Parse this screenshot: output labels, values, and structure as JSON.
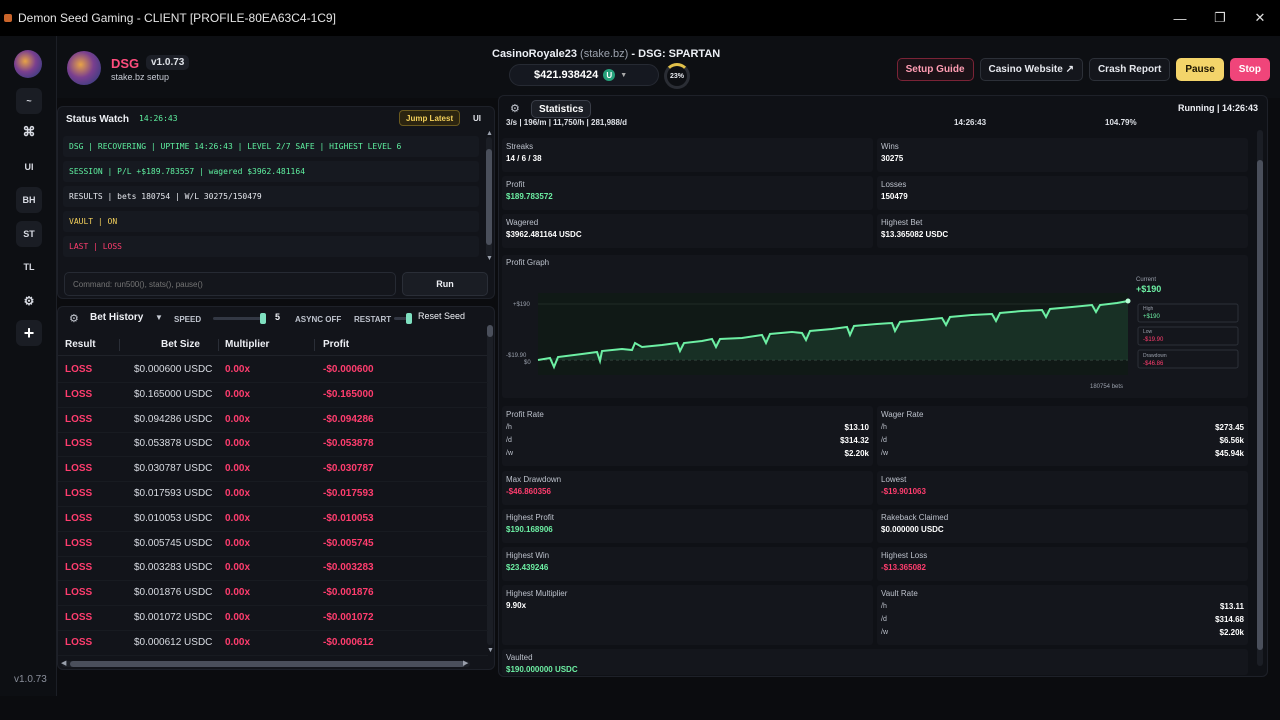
{
  "window": {
    "title": "Demon Seed Gaming - CLIENT [PROFILE-80EA63C4-1C9]",
    "controls": [
      "—",
      "❐",
      "✕"
    ]
  },
  "rail": {
    "items": [
      "~",
      "⌘",
      "UI",
      "BH",
      "ST",
      "TL",
      "⚙",
      "+"
    ],
    "version": "v1.0.73"
  },
  "header": {
    "name": "DSG",
    "version": "v1.0.73",
    "subtitle": "stake.bz setup",
    "account": "CasinoRoyale23",
    "account_site": "(stake.bz)",
    "account_mode": "- DSG: SPARTAN",
    "balance": "$421.938424",
    "coin_letter": "U",
    "progress_pct": 23,
    "progress_label": "23%",
    "buttons": {
      "setup_guide": "Setup Guide",
      "casino_website": "Casino Website ↗",
      "crash_report": "Crash Report",
      "pause": "Pause",
      "stop": "Stop"
    }
  },
  "status_watch": {
    "title": "Status Watch",
    "time": "14:26:43",
    "jump_latest": "Jump Latest",
    "ui": "UI",
    "lines": [
      {
        "text": "DSG | RECOVERING | UPTIME 14:26:43 | LEVEL 2/7 SAFE | HIGHEST LEVEL 6",
        "color": "#5ff0a0"
      },
      {
        "text": "SESSION | P/L +$189.783557 | wagered $3962.481164",
        "color": "#5ff0a0"
      },
      {
        "text": "RESULTS | bets 180754 | W/L 30275/150479",
        "color": "#e6e8ee"
      },
      {
        "text": "VAULT | ON",
        "color": "#f2cf5b"
      },
      {
        "text": "LAST | LOSS",
        "color": "#ff3d6e"
      }
    ],
    "command_placeholder": "Command: run500(), stats(), pause()",
    "run": "Run"
  },
  "bet_history": {
    "selector": "Bet History",
    "speed_label": "SPEED",
    "speed_value": "5",
    "async_label": "ASYNC OFF",
    "restart_label": "RESTART",
    "reset_seed": "Reset Seed",
    "columns": [
      "Result",
      "Bet Size",
      "Multiplier",
      "Profit"
    ],
    "rows": [
      [
        "LOSS",
        "$0.000600 USDC",
        "0.00x",
        "-$0.000600"
      ],
      [
        "LOSS",
        "$0.165000 USDC",
        "0.00x",
        "-$0.165000"
      ],
      [
        "LOSS",
        "$0.094286 USDC",
        "0.00x",
        "-$0.094286"
      ],
      [
        "LOSS",
        "$0.053878 USDC",
        "0.00x",
        "-$0.053878"
      ],
      [
        "LOSS",
        "$0.030787 USDC",
        "0.00x",
        "-$0.030787"
      ],
      [
        "LOSS",
        "$0.017593 USDC",
        "0.00x",
        "-$0.017593"
      ],
      [
        "LOSS",
        "$0.010053 USDC",
        "0.00x",
        "-$0.010053"
      ],
      [
        "LOSS",
        "$0.005745 USDC",
        "0.00x",
        "-$0.005745"
      ],
      [
        "LOSS",
        "$0.003283 USDC",
        "0.00x",
        "-$0.003283"
      ],
      [
        "LOSS",
        "$0.001876 USDC",
        "0.00x",
        "-$0.001876"
      ],
      [
        "LOSS",
        "$0.001072 USDC",
        "0.00x",
        "-$0.001072"
      ],
      [
        "LOSS",
        "$0.000612 USDC",
        "0.00x",
        "-$0.000612"
      ]
    ]
  },
  "statistics": {
    "tab": "Statistics",
    "running": "Running | 14:26:43",
    "top_strip": [
      "3/s | 196/m | 11,750/h | 281,988/d",
      "14:26:43",
      "104.79%"
    ],
    "cards": [
      {
        "k": "Streaks",
        "v": "14 / 6 / 38",
        "c": ""
      },
      {
        "k": "Wins",
        "v": "30275",
        "c": ""
      },
      {
        "k": "Profit",
        "v": "$189.783572",
        "c": "g"
      },
      {
        "k": "Losses",
        "v": "150479",
        "c": ""
      },
      {
        "k": "Wagered",
        "v": "$3962.481164 USDC",
        "c": ""
      },
      {
        "k": "Highest Bet",
        "v": "$13.365082 USDC",
        "c": ""
      }
    ],
    "graph": {
      "title": "Profit Graph",
      "y_top": "+$190",
      "y_bottom": "-$19.90",
      "y_zero": "$0",
      "x_label": "180754 bets",
      "current_label": "Current",
      "current_value": "+$190",
      "high_label": "High",
      "high_value": "+$190",
      "low_label": "Low",
      "low_value": "-$19.90",
      "drawdown_label": "Drawdown",
      "drawdown_value": "-$46.86"
    },
    "profit_rate": {
      "k": "Profit Rate",
      "rows": [
        [
          "/h",
          "$13.10"
        ],
        [
          "/d",
          "$314.32"
        ],
        [
          "/w",
          "$2.20k"
        ]
      ]
    },
    "wager_rate": {
      "k": "Wager Rate",
      "rows": [
        [
          "/h",
          "$273.45"
        ],
        [
          "/d",
          "$6.56k"
        ],
        [
          "/w",
          "$45.94k"
        ]
      ]
    },
    "cards2": [
      {
        "k": "Max Drawdown",
        "v": "-$46.860356",
        "c": "r"
      },
      {
        "k": "Lowest",
        "v": "-$19.901063",
        "c": "r"
      },
      {
        "k": "Highest Profit",
        "v": "$190.168906",
        "c": "g"
      },
      {
        "k": "Rakeback Claimed",
        "v": "$0.000000 USDC",
        "c": ""
      },
      {
        "k": "Highest Win",
        "v": "$23.439246",
        "c": "g"
      },
      {
        "k": "Highest Loss",
        "v": "-$13.365082",
        "c": "r"
      }
    ],
    "highest_multiplier": {
      "k": "Highest Multiplier",
      "v": "9.90x"
    },
    "vault_rate": {
      "k": "Vault Rate",
      "rows": [
        [
          "/h",
          "$13.11"
        ],
        [
          "/d",
          "$314.68"
        ],
        [
          "/w",
          "$2.20k"
        ]
      ]
    },
    "vaulted": {
      "k": "Vaulted",
      "v": "$190.000000 USDC"
    }
  },
  "colors": {
    "accent_pink": "#ff3d6e",
    "accent_green": "#6df0a4",
    "pause_yellow": "#f3d46a",
    "stop_pink": "#f0457a"
  }
}
